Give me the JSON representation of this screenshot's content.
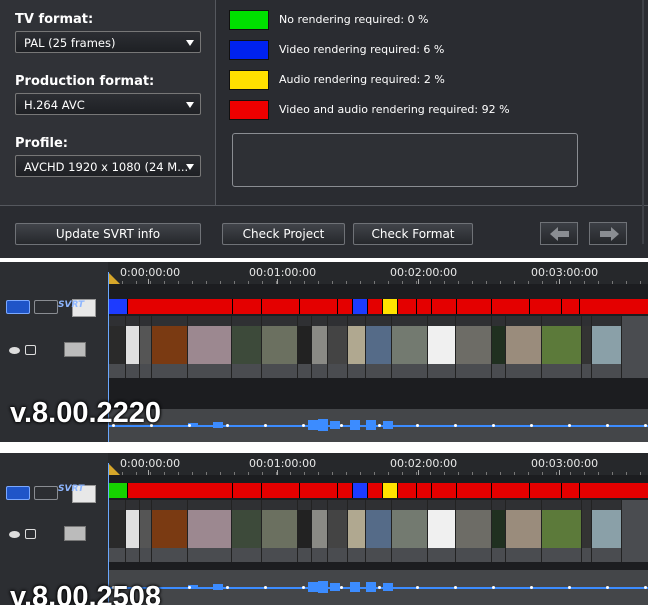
{
  "settings": {
    "tv_format_label": "TV format:",
    "tv_format_value": "PAL (25 frames)",
    "production_format_label": "Production format:",
    "production_format_value": "H.264 AVC",
    "profile_label": "Profile:",
    "profile_value": "AVCHD 1920 x 1080 (24 M..."
  },
  "legend": [
    {
      "label": "No rendering required: 0 %",
      "color": "#00e000"
    },
    {
      "label": "Video rendering required: 6 %",
      "color": "#0022ee"
    },
    {
      "label": "Audio rendering required: 2 %",
      "color": "#ffe000"
    },
    {
      "label": "Video and audio rendering required: 92 %",
      "color": "#ee0000"
    }
  ],
  "buttons": {
    "update_svrt": "Update SVRT info",
    "check_project": "Check Project",
    "check_format": "Check Format"
  },
  "timeline": {
    "timecodes": [
      "0:00:00:00",
      "00:01:00:00",
      "00:02:00:00",
      "00:03:00:00"
    ],
    "svrt_label": "SVRT"
  },
  "versions": {
    "top": "v.8.00.2220",
    "bottom": "v.8.00.2508"
  },
  "colors": {
    "red": "#e40000",
    "blue": "#1d3bff",
    "yellow": "#ffe200",
    "green": "#16d200"
  },
  "svrt_top": [
    "blue",
    "red",
    "red",
    "red",
    "red",
    "red",
    "blue",
    "red",
    "yellow",
    "red",
    "red",
    "red",
    "red",
    "red",
    "red",
    "red",
    "red"
  ],
  "svrt_bottom": [
    "green",
    "red",
    "red",
    "red",
    "red",
    "red",
    "blue",
    "red",
    "yellow",
    "red",
    "red",
    "red",
    "red",
    "red",
    "red",
    "red",
    "red"
  ]
}
